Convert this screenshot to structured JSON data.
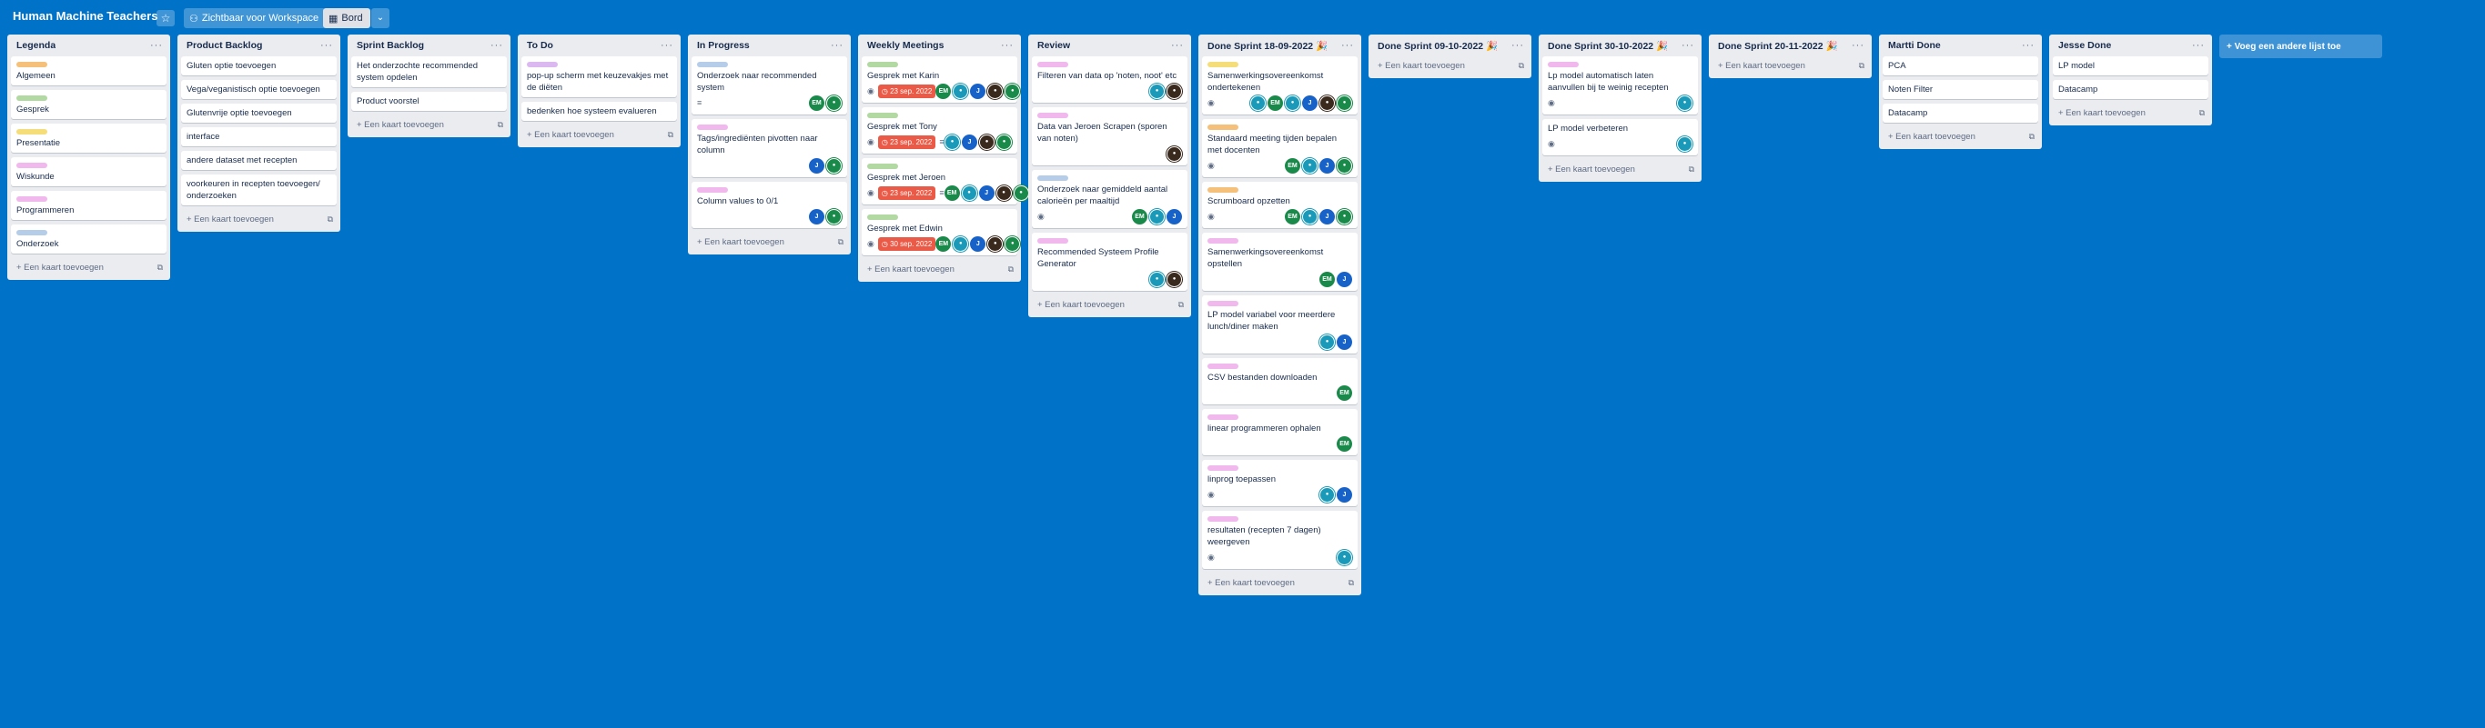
{
  "header": {
    "board_title": "Human Machine Teachers",
    "star_icon": "star-icon",
    "visibility_label": "Zichtbaar voor Workspace",
    "view_label": "Bord"
  },
  "add_card_label": "+ Een kaart toevoegen",
  "add_list_label": "+ Voeg een andere lijst toe",
  "colors": {
    "background": "#0072c8",
    "green": "#b3d9a3",
    "yellow": "#f5dd7a",
    "pink": "#f0b8ec",
    "purple": "#dcb8f0",
    "blue": "#b5cde8",
    "due_red": "#eb5a46"
  },
  "lists": [
    {
      "title": "Legenda",
      "cards": [
        {
          "label": "#f5c07a",
          "title": "Algemeen"
        },
        {
          "label": "#b3d9a3",
          "title": "Gesprek"
        },
        {
          "label": "#f5dd7a",
          "title": "Presentatie"
        },
        {
          "label": "#f0b8ec",
          "title": "Wiskunde"
        },
        {
          "label": "#f0b8ec",
          "title": "Programmeren"
        },
        {
          "label": "#b5cde8",
          "title": "Onderzoek"
        }
      ]
    },
    {
      "title": "Product Backlog",
      "cards": [
        {
          "title": "Gluten optie toevoegen"
        },
        {
          "title": "Vega/veganistisch optie toevoegen"
        },
        {
          "title": "Glutenvrije optie toevoegen"
        },
        {
          "title": "interface"
        },
        {
          "title": "andere dataset met recepten"
        },
        {
          "title": "voorkeuren in recepten toevoegen/ onderzoeken"
        }
      ]
    },
    {
      "title": "Sprint Backlog",
      "cards": [
        {
          "title": "Het onderzochte recommended system opdelen"
        },
        {
          "title": "Product voorstel"
        }
      ]
    },
    {
      "title": "To Do",
      "cards": [
        {
          "label": "#dcb8f0",
          "title": "pop-up scherm met keuzevakjes met de diëten"
        },
        {
          "title": "bedenken hoe systeem evalueren"
        }
      ]
    },
    {
      "title": "In Progress",
      "cards": [
        {
          "label": "#b5cde8",
          "title": "Onderzoek naar recommended system",
          "desc": true,
          "members": [
            {
              "i": "EM",
              "c": "#1a8a4a"
            },
            {
              "i": "",
              "c": "#1a8a4a"
            }
          ]
        },
        {
          "label": "#f0b8ec",
          "title": "Tags/ingrediënten pivotten naar column",
          "members": [
            {
              "i": "J",
              "c": "#1762c9"
            },
            {
              "i": "",
              "c": "#1a8a4a"
            }
          ]
        },
        {
          "label": "#f0b8ec",
          "title": "Column values to 0/1",
          "members": [
            {
              "i": "J",
              "c": "#1762c9"
            },
            {
              "i": "",
              "c": "#1a8a4a"
            }
          ]
        }
      ]
    },
    {
      "title": "Weekly Meetings",
      "cards": [
        {
          "label": "#b3d9a3",
          "title": "Gesprek met Karin",
          "eye": true,
          "due": "23 sep. 2022",
          "members": [
            {
              "i": "EM",
              "c": "#1a8a4a"
            },
            {
              "i": "",
              "c": "#1a9ab8"
            },
            {
              "i": "J",
              "c": "#1762c9"
            },
            {
              "i": "",
              "c": "#3a2a1e"
            },
            {
              "i": "",
              "c": "#1a8a4a"
            }
          ]
        },
        {
          "label": "#b3d9a3",
          "title": "Gesprek met Tony",
          "eye": true,
          "due": "23 sep. 2022",
          "desc": true,
          "members": [
            {
              "i": "",
              "c": "#1a9ab8"
            },
            {
              "i": "J",
              "c": "#1762c9"
            },
            {
              "i": "",
              "c": "#3a2a1e"
            },
            {
              "i": "",
              "c": "#1a8a4a"
            }
          ]
        },
        {
          "label": "#b3d9a3",
          "title": "Gesprek met Jeroen",
          "eye": true,
          "due": "23 sep. 2022",
          "desc": true,
          "members": [
            {
              "i": "EM",
              "c": "#1a8a4a"
            },
            {
              "i": "",
              "c": "#1a9ab8"
            },
            {
              "i": "J",
              "c": "#1762c9"
            },
            {
              "i": "",
              "c": "#3a2a1e"
            },
            {
              "i": "",
              "c": "#1a8a4a"
            }
          ]
        },
        {
          "label": "#b3d9a3",
          "title": "Gesprek met Edwin",
          "eye": true,
          "due": "30 sep. 2022",
          "members": [
            {
              "i": "EM",
              "c": "#1a8a4a"
            },
            {
              "i": "",
              "c": "#1a9ab8"
            },
            {
              "i": "J",
              "c": "#1762c9"
            },
            {
              "i": "",
              "c": "#3a2a1e"
            },
            {
              "i": "",
              "c": "#1a8a4a"
            }
          ]
        }
      ]
    },
    {
      "title": "Review",
      "cards": [
        {
          "label": "#f0b8ec",
          "title": "Filteren van data op 'noten, noot' etc",
          "members": [
            {
              "i": "",
              "c": "#1a9ab8"
            },
            {
              "i": "",
              "c": "#3a2a1e"
            }
          ]
        },
        {
          "label": "#f0b8ec",
          "title": "Data van Jeroen Scrapen (sporen van noten)",
          "members": [
            {
              "i": "",
              "c": "#3a2a1e"
            }
          ]
        },
        {
          "label": "#b5cde8",
          "title": "Onderzoek naar gemiddeld aantal calorieën per maaltijd",
          "eye": true,
          "members": [
            {
              "i": "EM",
              "c": "#1a8a4a"
            },
            {
              "i": "",
              "c": "#1a9ab8"
            },
            {
              "i": "J",
              "c": "#1762c9"
            }
          ]
        },
        {
          "label": "#f0b8ec",
          "title": "Recommended Systeem Profile Generator",
          "members": [
            {
              "i": "",
              "c": "#1a9ab8"
            },
            {
              "i": "",
              "c": "#3a2a1e"
            }
          ]
        }
      ]
    },
    {
      "title": "Done Sprint 18-09-2022 🎉",
      "cards": [
        {
          "label": "#f5dd7a",
          "title": "Samenwerkingsovereenkomst ondertekenen",
          "eye": true,
          "members": [
            {
              "i": "",
              "c": "#1a9ab8"
            },
            {
              "i": "EM",
              "c": "#1a8a4a"
            },
            {
              "i": "",
              "c": "#1a9ab8"
            },
            {
              "i": "J",
              "c": "#1762c9"
            },
            {
              "i": "",
              "c": "#3a2a1e"
            },
            {
              "i": "",
              "c": "#1a8a4a"
            }
          ]
        },
        {
          "label": "#f5c07a",
          "title": "Standaard meeting tijden bepalen met docenten",
          "eye": true,
          "members": [
            {
              "i": "EM",
              "c": "#1a8a4a"
            },
            {
              "i": "",
              "c": "#1a9ab8"
            },
            {
              "i": "J",
              "c": "#1762c9"
            },
            {
              "i": "",
              "c": "#1a8a4a"
            }
          ]
        },
        {
          "label": "#f5c07a",
          "title": "Scrumboard opzetten",
          "eye": true,
          "members": [
            {
              "i": "EM",
              "c": "#1a8a4a"
            },
            {
              "i": "",
              "c": "#1a9ab8"
            },
            {
              "i": "J",
              "c": "#1762c9"
            },
            {
              "i": "",
              "c": "#1a8a4a"
            }
          ]
        },
        {
          "label": "#f0b8ec",
          "title": "Samenwerkingsovereenkomst opstellen",
          "members": [
            {
              "i": "EM",
              "c": "#1a8a4a"
            },
            {
              "i": "J",
              "c": "#1762c9"
            }
          ]
        },
        {
          "label": "#f0b8ec",
          "title": "LP model variabel voor meerdere lunch/diner maken",
          "members": [
            {
              "i": "",
              "c": "#1a9ab8"
            },
            {
              "i": "J",
              "c": "#1762c9"
            }
          ]
        },
        {
          "label": "#f0b8ec",
          "title": "CSV bestanden downloaden",
          "members": [
            {
              "i": "EM",
              "c": "#1a8a4a"
            }
          ]
        },
        {
          "label": "#f0b8ec",
          "title": "linear programmeren ophalen",
          "members": [
            {
              "i": "EM",
              "c": "#1a8a4a"
            }
          ]
        },
        {
          "label": "#f0b8ec",
          "title": "linprog toepassen",
          "eye": true,
          "members": [
            {
              "i": "",
              "c": "#1a9ab8"
            },
            {
              "i": "J",
              "c": "#1762c9"
            }
          ]
        },
        {
          "label": "#f0b8ec",
          "title": "resultaten (recepten 7 dagen) weergeven",
          "eye": true,
          "members": [
            {
              "i": "",
              "c": "#1a9ab8"
            }
          ]
        }
      ]
    },
    {
      "title": "Done Sprint 09-10-2022 🎉",
      "cards": []
    },
    {
      "title": "Done Sprint 30-10-2022 🎉",
      "cards": [
        {
          "label": "#f0b8ec",
          "title": "Lp model automatisch laten aanvullen bij te weinig recepten",
          "eye": true,
          "members": [
            {
              "i": "",
              "c": "#1a9ab8"
            }
          ]
        },
        {
          "title": "LP model verbeteren",
          "eye": true,
          "members": [
            {
              "i": "",
              "c": "#1a9ab8"
            }
          ]
        }
      ]
    },
    {
      "title": "Done Sprint 20-11-2022 🎉",
      "cards": []
    },
    {
      "title": "Martti Done",
      "cards": [
        {
          "title": "PCA"
        },
        {
          "title": "Noten Filter"
        },
        {
          "title": "Datacamp"
        }
      ]
    },
    {
      "title": "Jesse Done",
      "cards": [
        {
          "title": "LP model"
        },
        {
          "title": "Datacamp"
        }
      ]
    }
  ]
}
